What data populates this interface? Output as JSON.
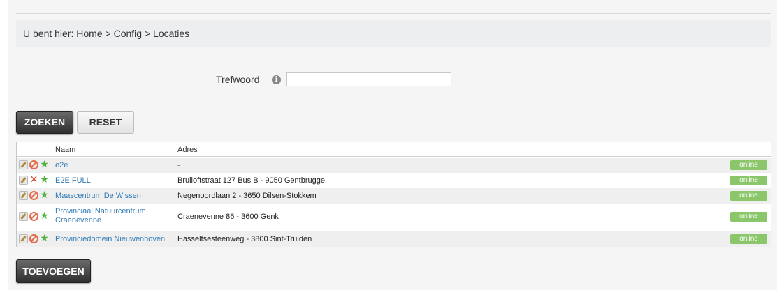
{
  "breadcrumb": {
    "prefix": "U bent hier:",
    "home": "Home",
    "sep1": ">",
    "config": "Config",
    "sep2": ">",
    "current": "Locaties"
  },
  "search": {
    "label": "Trefwoord",
    "info_symbol": "i",
    "value": "",
    "placeholder": ""
  },
  "buttons": {
    "search": "ZOEKEN",
    "reset": "RESET",
    "add": "TOEVOEGEN"
  },
  "table": {
    "headers": {
      "name": "Naam",
      "address": "Adres"
    },
    "rows": [
      {
        "name": "e2e",
        "address": "-",
        "status": "online",
        "second_icon": "disable-icon"
      },
      {
        "name": "E2E FULL",
        "address": "Bruiloftstraat 127 Bus B - 9050 Gentbrugge",
        "status": "online",
        "second_icon": "delete-icon"
      },
      {
        "name": "Maascentrum De Wissen",
        "address": "Negenoordlaan 2 - 3650 Dilsen-Stokkem",
        "status": "online",
        "second_icon": "disable-icon"
      },
      {
        "name": "Provinciaal Natuurcentrum Craenevenne",
        "address": "Craenevenne 86 - 3600 Genk",
        "status": "online",
        "second_icon": "disable-icon"
      },
      {
        "name": "Provinciedomein Nieuwenhoven",
        "address": "Hasseltsesteenweg - 3800 Sint-Truiden",
        "status": "online",
        "second_icon": "disable-icon"
      }
    ]
  },
  "colors": {
    "link": "#2f7ab5",
    "status_online": "#8bc66a",
    "primary_button": "#3a3a3a"
  }
}
